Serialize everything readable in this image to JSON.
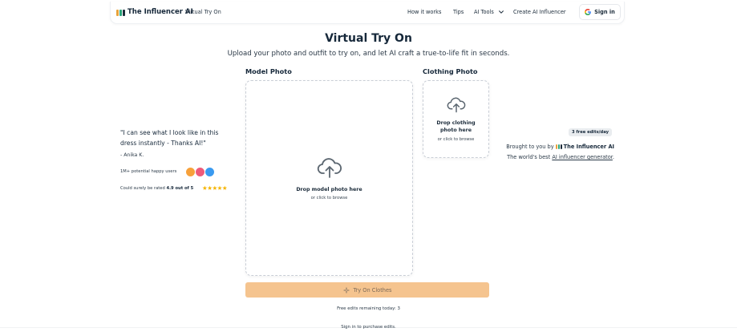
{
  "header": {
    "brand": "The Influencer AI",
    "brand_sub": "Virtual Try On",
    "nav": [
      {
        "label": "How it works"
      },
      {
        "label": "Tips"
      },
      {
        "label": "AI Tools"
      },
      {
        "label": "Create AI Influencer"
      }
    ],
    "signin_label": "Sign in",
    "logo_colors": [
      "#e8a23a",
      "#2aa57a",
      "#1b2b3a"
    ]
  },
  "hero": {
    "title": "Virtual Try On",
    "subtitle": "Upload your photo and outfit to try on, and let AI craft a true-to-life fit in seconds."
  },
  "model_panel": {
    "label": "Model Photo",
    "drop_text": "Drop model photo here",
    "browse_text": "or click to browse"
  },
  "clothing_panel": {
    "label": "Clothing Photo",
    "drop_text_1": "Drop clothing",
    "drop_text_2": "photo here",
    "browse_text": "or click to browse"
  },
  "testimonial": {
    "quote": "\"I can see what I look like in this dress instantly - Thanks AI!\"",
    "author": "- Anika K.",
    "users_text": "1M+ potential happy users",
    "avatar_colors": [
      "#f7a13a",
      "#ee5a7a",
      "#3a9af0"
    ],
    "rated_prefix": "Could surely be rated",
    "rating": "4.9 out of 5",
    "stars": "★★★★★",
    "star_color": "#f5b400"
  },
  "promo": {
    "badge": "3 free edits/day",
    "brought_prefix": "Brought to you by",
    "brand": "The Influencer AI",
    "best_prefix": "The world's best",
    "best_link": "AI influencer generator",
    "best_suffix": "."
  },
  "cta": {
    "try_label": "Try On Clothes",
    "button_color": "#f5c48f",
    "remaining": "Free edits remaining today: 3",
    "signin_note": "Sign in to purchase edits."
  }
}
